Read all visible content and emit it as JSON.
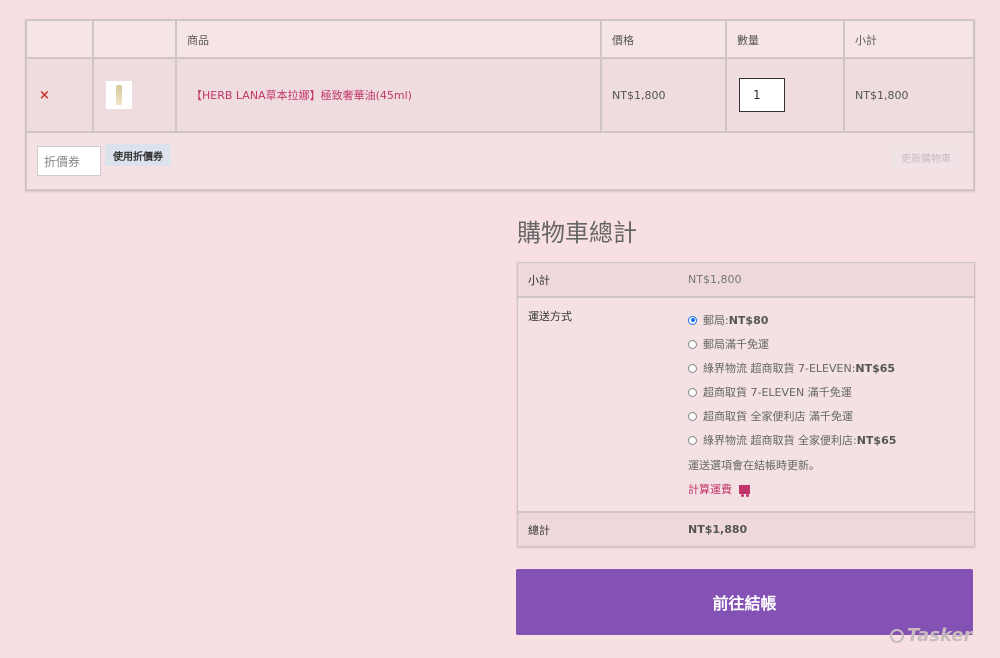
{
  "cart": {
    "headers": [
      "",
      "",
      "商品",
      "價格",
      "數量",
      "小計"
    ],
    "item": {
      "remove": "×",
      "name": "【HERB LANA草本拉娜】極致奢華油(45ml)",
      "price": "NT$1,800",
      "quantity": "1",
      "subtotal": "NT$1,800"
    },
    "coupon_placeholder": "折價券",
    "apply_coupon_label": "使用折價券",
    "update_cart_label": "更新購物車"
  },
  "totals": {
    "title": "購物車總計",
    "subtotal_label": "小計",
    "subtotal_value": "NT$1,800",
    "shipping_label": "運送方式",
    "shipping_options": [
      {
        "label": "郵局: ",
        "price": "NT$80",
        "checked": true
      },
      {
        "label": "郵局滿千免運",
        "price": "",
        "checked": false
      },
      {
        "label": "綠界物流 超商取貨 7-ELEVEN: ",
        "price": "NT$65",
        "checked": false
      },
      {
        "label": "超商取貨 7-ELEVEN 滿千免運",
        "price": "",
        "checked": false
      },
      {
        "label": "超商取貨 全家便利店 滿千免運",
        "price": "",
        "checked": false
      },
      {
        "label": "綠界物流 超商取貨 全家便利店: ",
        "price": "NT$65",
        "checked": false
      }
    ],
    "shipping_note": "運送選項會在結帳時更新。",
    "calc_shipping_label": "計算運費",
    "total_label": "總計",
    "total_value": "NT$1,880"
  },
  "checkout_label": "前往結帳",
  "watermark": "Tasker",
  "colors": {
    "accent": "#8352b4",
    "link": "#c2356b",
    "background": "#f7dfe2"
  }
}
